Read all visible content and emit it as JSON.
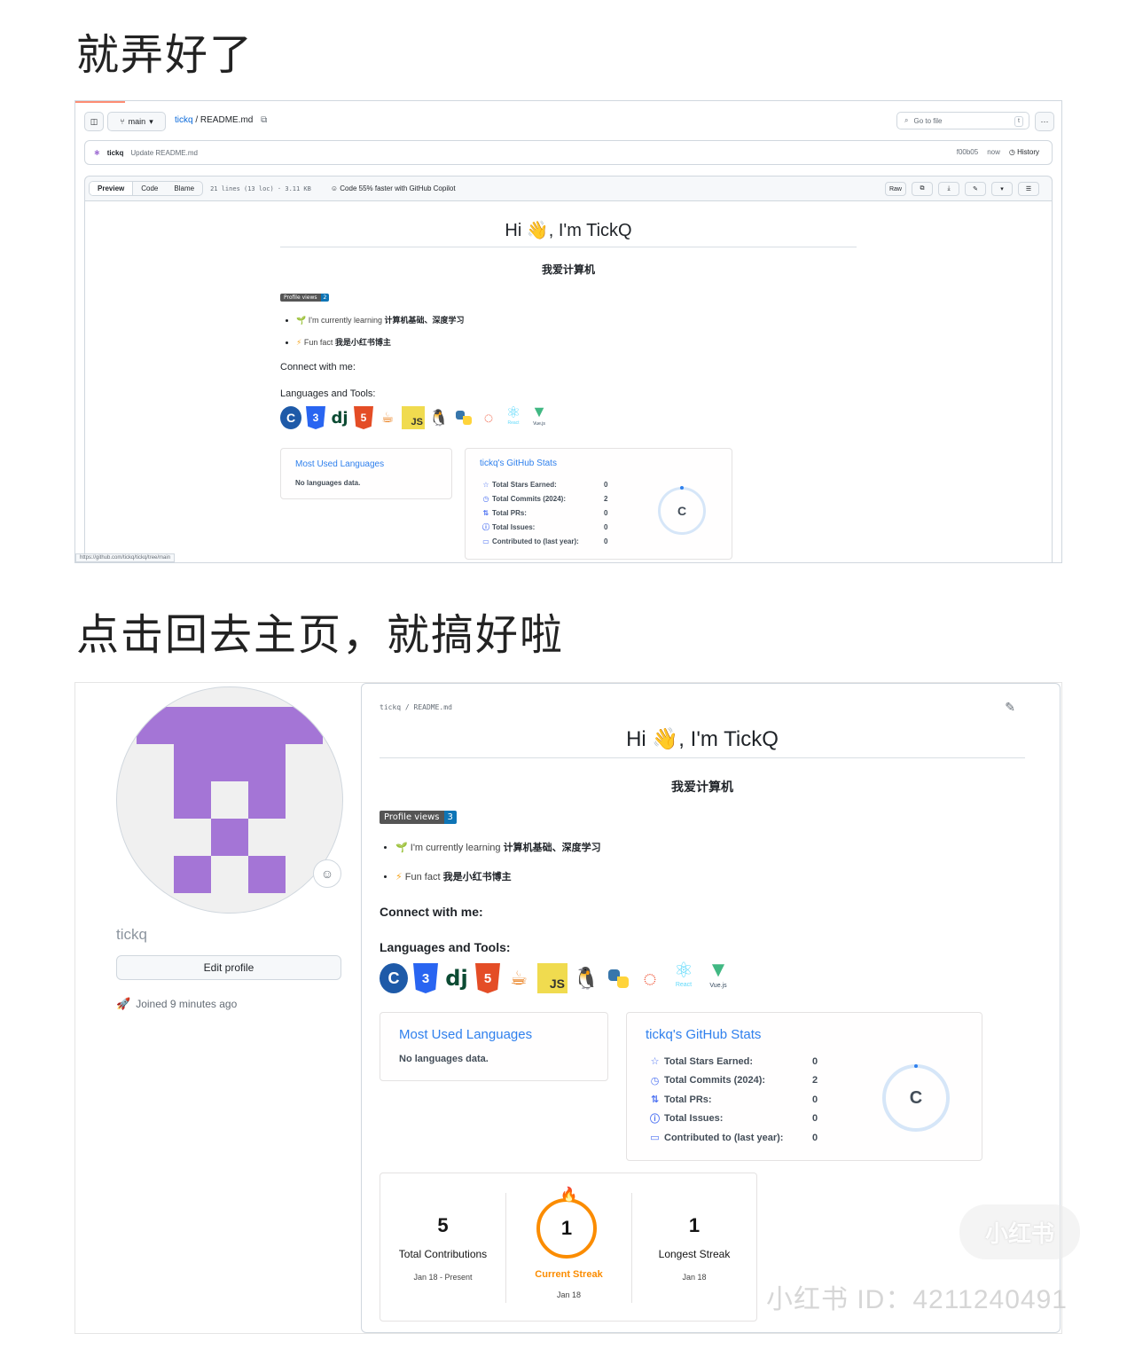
{
  "headings": {
    "first": "就弄好了",
    "second": "点击回去主页，就搞好啦"
  },
  "file_view": {
    "branch": "main",
    "breadcrumb_repo": "tickq",
    "breadcrumb_sep": " / ",
    "breadcrumb_file": "README.md",
    "go_to_file": "Go to file",
    "go_to_file_key": "t",
    "commit_author": "tickq",
    "commit_message": "Update README.md",
    "commit_hash": "f00b05",
    "commit_time": "now",
    "history_label": "History",
    "tabs": [
      "Preview",
      "Code",
      "Blame"
    ],
    "file_meta": "21 lines (13 loc) · 3.11 KB",
    "copilot_note": "Code 55% faster with GitHub Copilot",
    "raw_label": "Raw",
    "status_url": "https://github.com/tickq/tickq/tree/main",
    "profile_views_count": "2"
  },
  "profile": {
    "username": "tickq",
    "edit_button": "Edit profile",
    "joined": "Joined 9 minutes ago",
    "breadcrumb_path": "tickq / README.md",
    "profile_views_count": "3"
  },
  "readme": {
    "greeting": "Hi 👋, I'm TickQ",
    "subtitle": "我爱计算机",
    "badge_label": "Profile views",
    "bullet1_prefix": "I'm currently learning ",
    "bullet1_bold": "计算机基础、深度学习",
    "bullet2_prefix": "Fun fact ",
    "bullet2_bold": "我是小红书博主",
    "connect": "Connect with me:",
    "languages_tools": "Languages and Tools:",
    "tool_icons": [
      "c-icon",
      "css3-icon",
      "django-icon",
      "html5-icon",
      "java-icon",
      "javascript-icon",
      "linux-icon",
      "python-icon",
      "pytorch-icon",
      "react-icon",
      "vuejs-icon"
    ],
    "tool_captions": {
      "css": "CSS",
      "html": "HTML",
      "dj": "dj",
      "js": "JS",
      "react": "React",
      "vue": "Vue.js"
    },
    "most_used_title": "Most Used Languages",
    "no_lang": "No languages data.",
    "stats_title": "tickq's GitHub Stats",
    "stats": [
      {
        "label": "Total Stars Earned:",
        "value": "0",
        "icon": "star-icon"
      },
      {
        "label": "Total Commits (2024):",
        "value": "2",
        "icon": "history-icon"
      },
      {
        "label": "Total PRs:",
        "value": "0",
        "icon": "pr-icon"
      },
      {
        "label": "Total Issues:",
        "value": "0",
        "icon": "issue-icon"
      },
      {
        "label": "Contributed to (last year):",
        "value": "0",
        "icon": "repo-icon"
      }
    ],
    "rank": "C"
  },
  "streak": {
    "total": "5",
    "total_label": "Total Contributions",
    "total_range": "Jan 18 - Present",
    "current": "1",
    "current_label": "Current Streak",
    "current_range": "Jan 18",
    "longest": "1",
    "longest_label": "Longest Streak",
    "longest_range": "Jan 18"
  },
  "watermark": {
    "logo": "小红书",
    "text": "小红书  ID：4211240491"
  },
  "colors": {
    "accent_link": "#0969da",
    "card_title": "#2f80ed",
    "stat_icon": "#4c71f2",
    "streak_orange": "#fb8c00",
    "avatar_purple": "#a475d6"
  }
}
